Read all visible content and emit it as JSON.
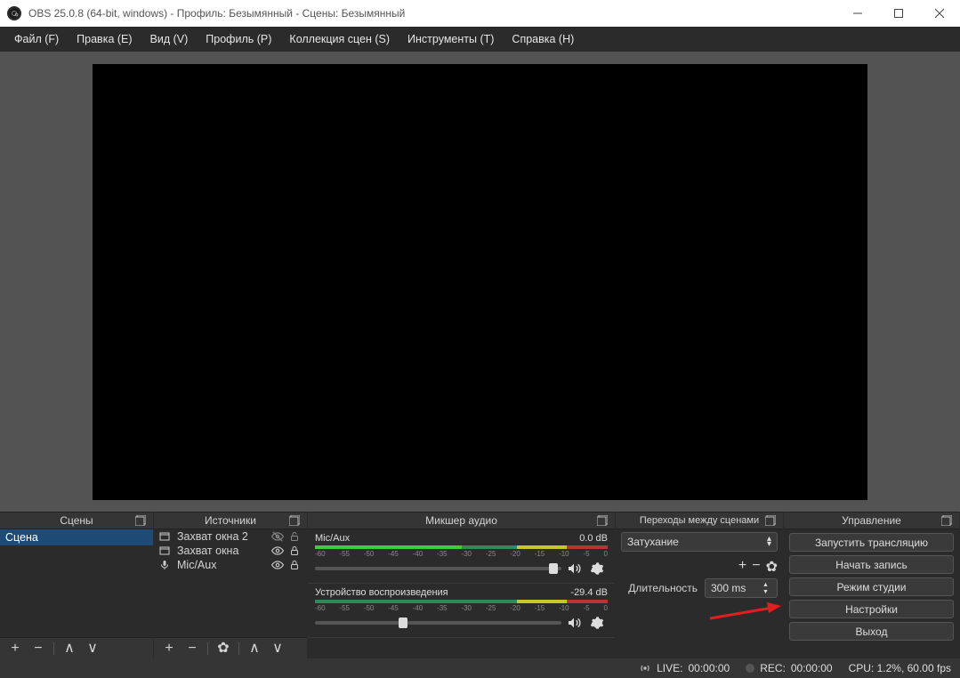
{
  "window": {
    "title": "OBS 25.0.8 (64-bit, windows) - Профиль: Безымянный - Сцены: Безымянный"
  },
  "menu": {
    "file": "Файл (F)",
    "edit": "Правка (E)",
    "view": "Вид (V)",
    "profile": "Профиль (P)",
    "scene_collection": "Коллекция сцен (S)",
    "tools": "Инструменты (T)",
    "help": "Справка (H)"
  },
  "docks": {
    "scenes": {
      "title": "Сцены",
      "items": [
        "Сцена"
      ]
    },
    "sources": {
      "title": "Источники",
      "items": [
        {
          "icon": "window",
          "label": "Захват окна 2",
          "visible": false,
          "locked": false
        },
        {
          "icon": "window",
          "label": "Захват окна",
          "visible": true,
          "locked": true
        },
        {
          "icon": "mic",
          "label": "Mic/Aux",
          "visible": true,
          "locked": true
        }
      ]
    },
    "mixer": {
      "title": "Микшер аудио",
      "ticks": [
        "-60",
        "-55",
        "-50",
        "-45",
        "-40",
        "-35",
        "-30",
        "-25",
        "-20",
        "-15",
        "-10",
        "-5",
        "0"
      ],
      "channels": [
        {
          "name": "Mic/Aux",
          "db": "0.0 dB",
          "fill_pct": 50,
          "thumb_pct": 95
        },
        {
          "name": "Устройство воспроизведения",
          "db": "-29.4 dB",
          "fill_pct": 0,
          "thumb_pct": 34
        }
      ]
    },
    "transitions": {
      "title": "Переходы между сценами",
      "selected": "Затухание",
      "duration_label": "Длительность",
      "duration_value": "300 ms"
    },
    "controls": {
      "title": "Управление",
      "buttons": {
        "start_stream": "Запустить трансляцию",
        "start_record": "Начать запись",
        "studio_mode": "Режим студии",
        "settings": "Настройки",
        "exit": "Выход"
      }
    }
  },
  "status": {
    "live_label": "LIVE:",
    "live_time": "00:00:00",
    "rec_label": "REC:",
    "rec_time": "00:00:00",
    "cpu": "CPU: 1.2%, 60.00 fps"
  }
}
